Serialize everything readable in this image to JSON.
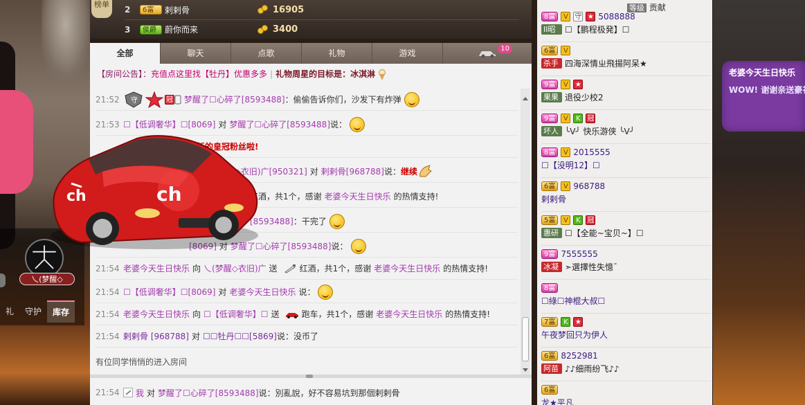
{
  "rank": {
    "badge_label": "榜单",
    "rows": [
      {
        "num": "2",
        "badge": "6富",
        "badge_style": "gold",
        "user": "剌剌骨",
        "score": "16905"
      },
      {
        "num": "3",
        "badge": "侯爵",
        "badge_style": "green",
        "user": "蔚你而来",
        "score": "3400"
      }
    ]
  },
  "tabs": [
    {
      "label": "全部",
      "active": true
    },
    {
      "label": "聊天",
      "active": false
    },
    {
      "label": "点歌",
      "active": false
    },
    {
      "label": "礼物",
      "active": false
    },
    {
      "label": "游戏",
      "active": false
    }
  ],
  "car_tab_count": "10",
  "notice": {
    "label": "【房间公告】：",
    "promo": "充值点这里找【牡丹】优惠多多",
    "goal": "礼物周星的目标是：冰淇淋"
  },
  "messages": [
    {
      "time": "21:52",
      "user": "梦醒了☐心碎了[8593488]",
      "text": "：偷偷告诉你们，沙发下有炸弹",
      "type": "chat"
    },
    {
      "time": "21:53",
      "user": "☐【低调奢华】☐[8069]",
      "to_label": "对",
      "to": "梦醒了☐心碎了[8593488]",
      "text": "说：",
      "type": "chat"
    },
    {
      "time": "",
      "text": "成为最新的皇冠粉丝啦!",
      "type": "system"
    },
    {
      "time": "",
      "user": "乀(梦醒◇衣旧)广[950321]",
      "to_label": "对",
      "to": "剌剌骨[968788]",
      "text": "说：",
      "extra": "继续",
      "type": "chat"
    },
    {
      "time": "",
      "text": "红酒，共1个，感谢",
      "thanks": "老婆今天生日快乐",
      "tail": "的热情支持!",
      "type": "gift"
    },
    {
      "time": "",
      "user": "[8593488]",
      "text": "：干完了",
      "type": "chat"
    },
    {
      "time": "",
      "user": "[8069]",
      "to_label": "对",
      "to": "梦醒了☐心碎了[8593488]",
      "text": "说：",
      "type": "chat"
    },
    {
      "time": "21:54",
      "user": "老婆今天生日快乐",
      "to_label": "向",
      "to": "乀(梦醒◇衣旧)广",
      "send": "送",
      "gift": "红酒，共1个，感谢",
      "thanks": "老婆今天生日快乐",
      "tail": "的热情支持!",
      "type": "gift"
    },
    {
      "time": "21:54",
      "user": "☐【低调奢华】☐[8069]",
      "to_label": "对",
      "to": "老婆今天生日快乐",
      "text": "说：",
      "type": "chat"
    },
    {
      "time": "21:54",
      "user": "老婆今天生日快乐",
      "to_label": "向",
      "to": "☐【低调奢华】☐",
      "send": "送",
      "gift": "跑车，共1个，感谢",
      "thanks": "老婆今天生日快乐",
      "tail": "的热情支持!",
      "type": "gift"
    },
    {
      "time": "21:54",
      "user": "剌剌骨 [968788]",
      "to_label": "对",
      "to": "☐☐牡丹☐☐[5869]",
      "text": "说：没币了",
      "type": "chat"
    }
  ],
  "enter_notice": "有位同学悄悄的进入房间",
  "my_message": {
    "time": "21:54",
    "me": "我",
    "to_label": "对",
    "to": "梦醒了☐心碎了[8593488]",
    "text": "说：別亂說，好不容易坑到那個剌剌骨"
  },
  "anchor": {
    "name": "乀(梦醒◇",
    "tabs": [
      "礼",
      "守护",
      "库存"
    ],
    "active_tab": "库存"
  },
  "audience_header": {
    "level": "等级",
    "label": "贡献"
  },
  "audience": [
    {
      "rank": "8富",
      "badges": [
        "V",
        "守",
        "★"
      ],
      "id": "5088888",
      "tag": "II昭",
      "tag_style": "brown",
      "name": "☐【鹏程极発】☐"
    },
    {
      "rank": "6富",
      "badges": [
        "V"
      ],
      "id": "",
      "tag": "杀手",
      "tag_style": "red",
      "name": "四海深情ㄓ飛揚阿呆★"
    },
    {
      "rank": "9富",
      "badges": [
        "V",
        "★"
      ],
      "id": "",
      "tag": "果果",
      "tag_style": "brown",
      "name": "退役少校2"
    },
    {
      "rank": "9富",
      "badges": [
        "V",
        "K",
        "冠"
      ],
      "id": "",
      "tag": "坏人",
      "tag_style": "brown",
      "name": "╰V╯ 快乐游侠 ╰V╯"
    },
    {
      "rank": "8富",
      "badges": [
        "V"
      ],
      "id": "2015555",
      "tag": "",
      "tag_style": "",
      "name": "☐【没明12】☐"
    },
    {
      "rank": "6富",
      "badges": [
        "V"
      ],
      "id": "968788",
      "tag": "",
      "tag_style": "",
      "name": "剌剌骨"
    },
    {
      "rank": "5富",
      "badges": [
        "V",
        "K",
        "冠"
      ],
      "id": "",
      "tag": "惠研",
      "tag_style": "brown",
      "name": "☐【全能~宝贝~】☐"
    },
    {
      "rank": "9富",
      "badges": [],
      "id": "7555555",
      "tag": "冰凝",
      "tag_style": "red",
      "name": "➣選擇性失憶ˉ"
    },
    {
      "rank": "8富",
      "badges": [],
      "id": "",
      "tag": "",
      "tag_style": "",
      "name": "☐綠☐神棍大叔☐"
    },
    {
      "rank": "7富",
      "badges": [
        "K",
        "★"
      ],
      "id": "",
      "tag": "",
      "tag_style": "",
      "name": "午夜梦回只为伊人"
    },
    {
      "rank": "6富",
      "badges": [],
      "id": "8252981",
      "tag": "阿苗",
      "tag_style": "red",
      "name": "♪♪细雨纷飞♪♪"
    },
    {
      "rank": "6富",
      "badges": [],
      "id": "",
      "tag": "",
      "tag_style": "",
      "name": "龙★平凡"
    }
  ],
  "bubble": {
    "title": "老婆今天生日快乐",
    "text": "WOW! 谢谢亲送豪礼，好激动啊"
  },
  "colors": {
    "accent_purple": "#a43bae",
    "tab_bar": "#7d6e64",
    "chat_bg": "#f2f2f2",
    "wealth_gold": "#e8a81c"
  }
}
